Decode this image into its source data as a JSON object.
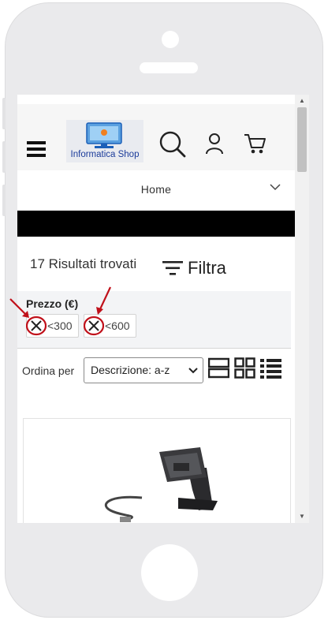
{
  "header": {
    "logo_text": "Informatica Shop"
  },
  "nav": {
    "home_label": "Home"
  },
  "results": {
    "count_text": "17 Risultati trovati",
    "filter_label": "Filtra"
  },
  "filters": {
    "price_title": "Prezzo (€)",
    "chips": [
      {
        "label": "<300"
      },
      {
        "label": "<600"
      }
    ]
  },
  "sort": {
    "label": "Ordina per",
    "selected": "Descrizione: a-z"
  },
  "icons": {
    "menu": "hamburger-icon",
    "search": "search-icon",
    "account": "user-icon",
    "cart": "cart-icon",
    "remove_filter": "close-icon",
    "view_modes": [
      "view-list-large-icon",
      "view-grid-icon",
      "view-list-icon"
    ]
  },
  "colors": {
    "annotation_red": "#c0101a",
    "logo_blue": "#1b3b9a"
  }
}
